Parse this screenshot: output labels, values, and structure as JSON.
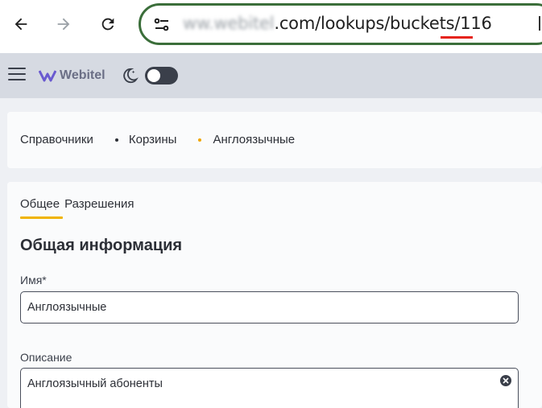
{
  "browser": {
    "url_blurred": "ww.webitel",
    "url_rest": ".com/lookups/buckets/",
    "url_id": "116"
  },
  "app": {
    "logo_text": "Webitel"
  },
  "breadcrumb": {
    "items": [
      "Справочники",
      "Корзины",
      "Англоязычные"
    ]
  },
  "tabs": [
    {
      "label": "Общее",
      "active": true
    },
    {
      "label": "Разрешения",
      "active": false
    }
  ],
  "form": {
    "section_title": "Общая информация",
    "name_label": "Имя*",
    "name_value": "Англоязычные",
    "description_label": "Описание",
    "description_value": "Англоязычный абоненты"
  },
  "colors": {
    "accent": "#f0b400",
    "url_border": "#3b6e3a",
    "header_bg": "#d6dae2"
  }
}
